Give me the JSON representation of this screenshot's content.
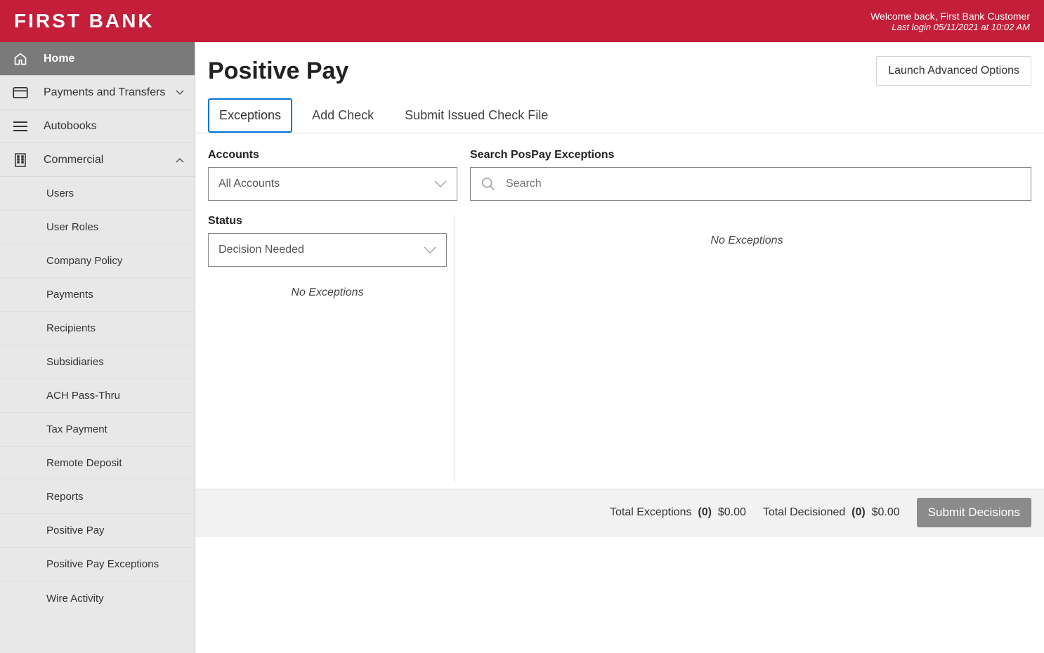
{
  "header": {
    "logo": "FIRST BANK",
    "welcome": "Welcome back, First Bank Customer",
    "last_login": "Last login 05/11/2021 at 10:02 AM"
  },
  "sidebar": {
    "home": "Home",
    "payments": "Payments and Transfers",
    "autobooks": "Autobooks",
    "commercial": "Commercial",
    "sub": {
      "users": "Users",
      "user_roles": "User Roles",
      "company_policy": "Company Policy",
      "payments": "Payments",
      "recipients": "Recipients",
      "subsidiaries": "Subsidiaries",
      "ach": "ACH Pass-Thru",
      "tax": "Tax Payment",
      "remote": "Remote Deposit",
      "reports": "Reports",
      "pospay": "Positive Pay",
      "pospay_ex": "Positive Pay Exceptions",
      "wire": "Wire Activity"
    }
  },
  "main": {
    "title": "Positive Pay",
    "launch_btn": "Launch Advanced Options",
    "tabs": {
      "exceptions": "Exceptions",
      "add_check": "Add Check",
      "submit_file": "Submit Issued Check File"
    },
    "filters": {
      "accounts_label": "Accounts",
      "accounts_value": "All Accounts",
      "search_label": "Search PosPay Exceptions",
      "search_placeholder": "Search",
      "status_label": "Status",
      "status_value": "Decision Needed"
    },
    "no_exceptions": "No Exceptions",
    "footer": {
      "total_ex_label": "Total Exceptions",
      "total_ex_count": "(0)",
      "total_ex_amt": "$0.00",
      "total_dec_label": "Total Decisioned",
      "total_dec_count": "(0)",
      "total_dec_amt": "$0.00",
      "submit_btn": "Submit Decisions"
    }
  }
}
